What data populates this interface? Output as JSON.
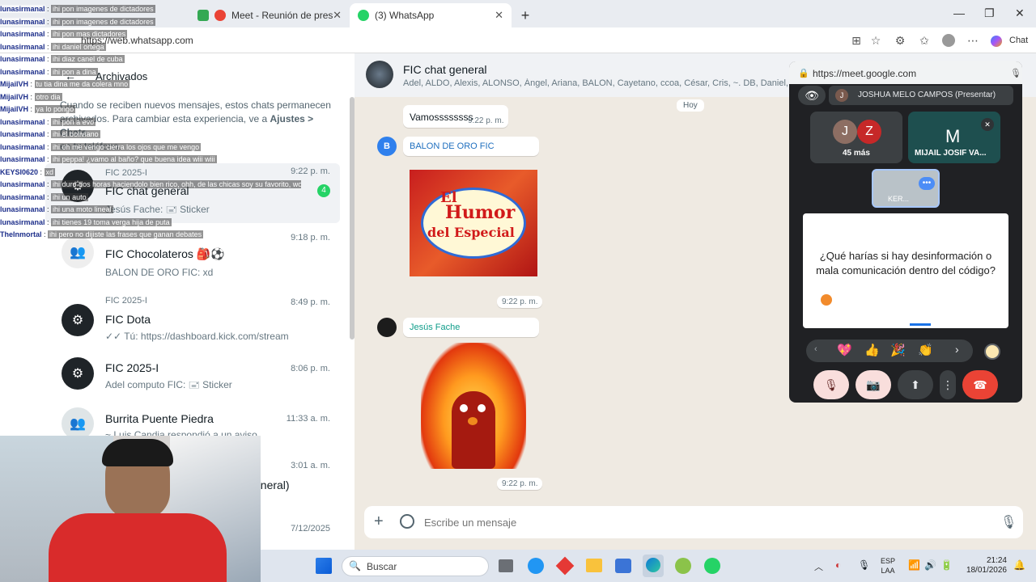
{
  "browser": {
    "tabs": [
      {
        "label": "Meet - Reunión de presentac",
        "active": false
      },
      {
        "label": "(3) WhatsApp",
        "active": true
      }
    ],
    "new_tab": "+",
    "url": "https://web.whatsapp.com",
    "chat_button": "Chat",
    "window_controls": [
      "—",
      "❐",
      "✕"
    ]
  },
  "left": {
    "archived_title": "Archivados",
    "archived_notice_1": "Cuando se reciben nuevos mensajes, estos chats permanecen",
    "archived_notice_2": "archivados. Para cambiar esta experiencia, ve a",
    "archived_notice_link": "Ajustes > Chats",
    "archived_notice_3": "en tu teléfono.",
    "chats": [
      {
        "group": "FIC 2025-I",
        "name": "FIC chat general",
        "sub": "Jesús Fache: 🖃 Sticker",
        "time": "9:22 p. m.",
        "unread": "4"
      },
      {
        "group": "FIC 2025-I",
        "name": "FIC Chocolateros 🎒⚽",
        "sub": "BALON DE ORO FIC: xd",
        "time": "9:18 p. m."
      },
      {
        "group": "FIC 2025-I",
        "name": "FIC Dota",
        "sub": "✓✓ Tú: https://dashboard.kick.com/stream",
        "time": "8:49 p. m."
      },
      {
        "group": "",
        "name": "FIC 2025-I",
        "sub": "Adel computo FIC: 🖃 Sticker",
        "time": "8:06 p. m."
      },
      {
        "group": "",
        "name": "Burrita Puente Piedra",
        "sub": "~ Luis Candia respondió a un aviso",
        "time": "11:33 a. m."
      },
      {
        "group": "",
        "name": "eneral)",
        "sub": "",
        "time": "3:01 a. m."
      },
      {
        "group": "",
        "name": "",
        "sub": "",
        "time": "7/12/2025"
      }
    ]
  },
  "conversation": {
    "title": "FIC chat general",
    "members": "Adel, ALDO, Alexis, ALONSO, Ángel, Ariana, BALON, Cayetano, ccoa, César, Cris, ~. DB, Daniel, Deleg",
    "date_label": "Hoy",
    "msg1_text": "Vamossssssss",
    "msg1_time": "9:22 p. m.",
    "msg2_sender": "BALON DE ORO FIC",
    "msg2_avatar": "B",
    "sticker1_line1": "El",
    "sticker1_line2": "Humor",
    "sticker1_line3": "del Especial",
    "msg2_time": "9:22 p. m.",
    "msg3_sender": "Jesús Fache",
    "msg3_time": "9:22 p. m.",
    "composer_placeholder": "Escribe un mensaje"
  },
  "meet": {
    "url": "https://meet.google.com",
    "presenter": "JOSHUA MELO CAMPOS (Presentar)",
    "presenter_initial": "J",
    "tile1_initials": [
      "J",
      "Z"
    ],
    "tile1_label": "45 más",
    "tile2_initial": "M",
    "tile2_label": "MIJAIL JOSIF VA...",
    "self_label": "KER...",
    "slide_text": "¿Qué harías si hay desinformación o mala comunicación dentro del código?",
    "reactions": [
      "💖",
      "👍",
      "🎉",
      "👏"
    ]
  },
  "taskbar": {
    "search": "Buscar",
    "lang1": "ESP",
    "lang2": "LAA",
    "time": "21:24",
    "date": "18/01/2026"
  },
  "stream_chat": [
    {
      "user": "lunasirmanal",
      "msg": "ihi pon imagenes de dictadores"
    },
    {
      "user": "lunasirmanal",
      "msg": "ihi pon imagenes de dictadores"
    },
    {
      "user": "lunasirmanal",
      "msg": "ihi pon mas dictadores"
    },
    {
      "user": "lunasirmanal",
      "msg": "ihi daniel ortega"
    },
    {
      "user": "lunasirmanal",
      "msg": "ihi diaz canel de cuba"
    },
    {
      "user": "lunasirmanal",
      "msg": "ihi pon a dina"
    },
    {
      "user": "MijailVH",
      "msg": "tu tia dina me da colera mno"
    },
    {
      "user": "MijailVH",
      "msg": "otro dia"
    },
    {
      "user": "MijailVH",
      "msg": "ya lo pongo"
    },
    {
      "user": "lunasirmanal",
      "msg": "ihi pon a evo"
    },
    {
      "user": "lunasirmanal",
      "msg": "ihi el boliviano"
    },
    {
      "user": "lunasirmanal",
      "msg": "ihi oh me vengo cierra los ojos que me vengo"
    },
    {
      "user": "lunasirmanal",
      "msg": "ihi peppa! ¿vamo al baño? que buena idea wiii wiii"
    },
    {
      "user": "KEYSI0620",
      "msg": "xd"
    },
    {
      "user": "lunasirmanal",
      "msg": "ihi duro dos horas haciendolo bien rico, ohh, de las chicas soy su favorito, wow"
    },
    {
      "user": "lunasirmanal",
      "msg": "ihi un auto"
    },
    {
      "user": "lunasirmanal",
      "msg": "ihi una moto lineal"
    },
    {
      "user": "lunasirmanal",
      "msg": "ihi tienes 19 toma verga hija de puta"
    },
    {
      "user": "TheInmortal",
      "msg": "ihi pero no dijiste las frases que ganan debates"
    }
  ],
  "colors": {
    "whatsapp_green": "#25d366",
    "end_call": "#ea4335",
    "meet_dark": "#202124"
  }
}
